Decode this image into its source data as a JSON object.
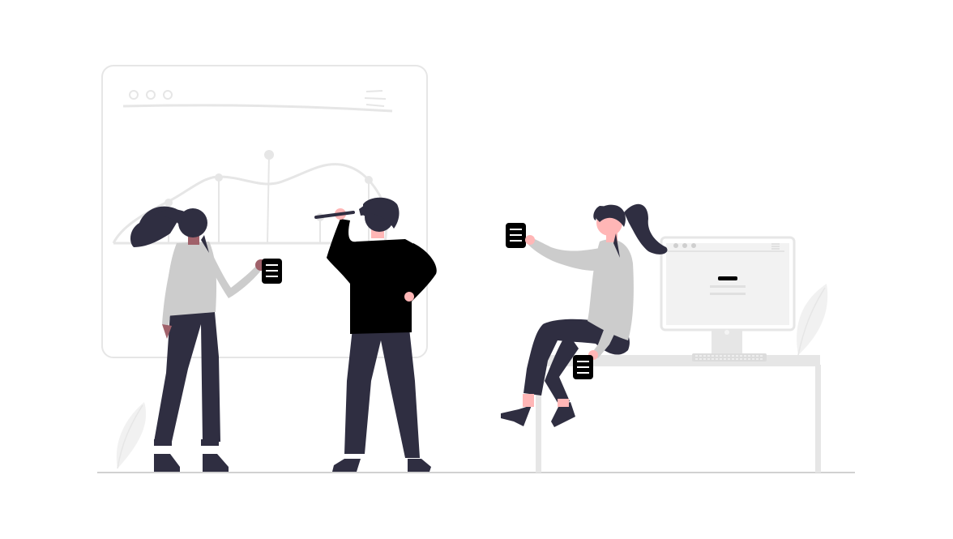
{
  "illustration": {
    "colors": {
      "background": "#ffffff",
      "outline": "#e6e6e6",
      "floor": "#d1d1d1",
      "shirt": "#cccccc",
      "pants": "#2f2e41",
      "jacket": "#000000",
      "skin_light": "#ffb6b6",
      "skin_dark": "#a0616a",
      "hair": "#2f2e41",
      "note": "#000000",
      "note_lines": "#ffffff",
      "leaf": "#f1f1f1",
      "desk": "#e6e6e6",
      "monitor": "#f2f2f2"
    },
    "icons": [
      "whiteboard-icon",
      "document-icon",
      "monitor-icon",
      "keyboard-icon",
      "leaf-icon"
    ]
  }
}
